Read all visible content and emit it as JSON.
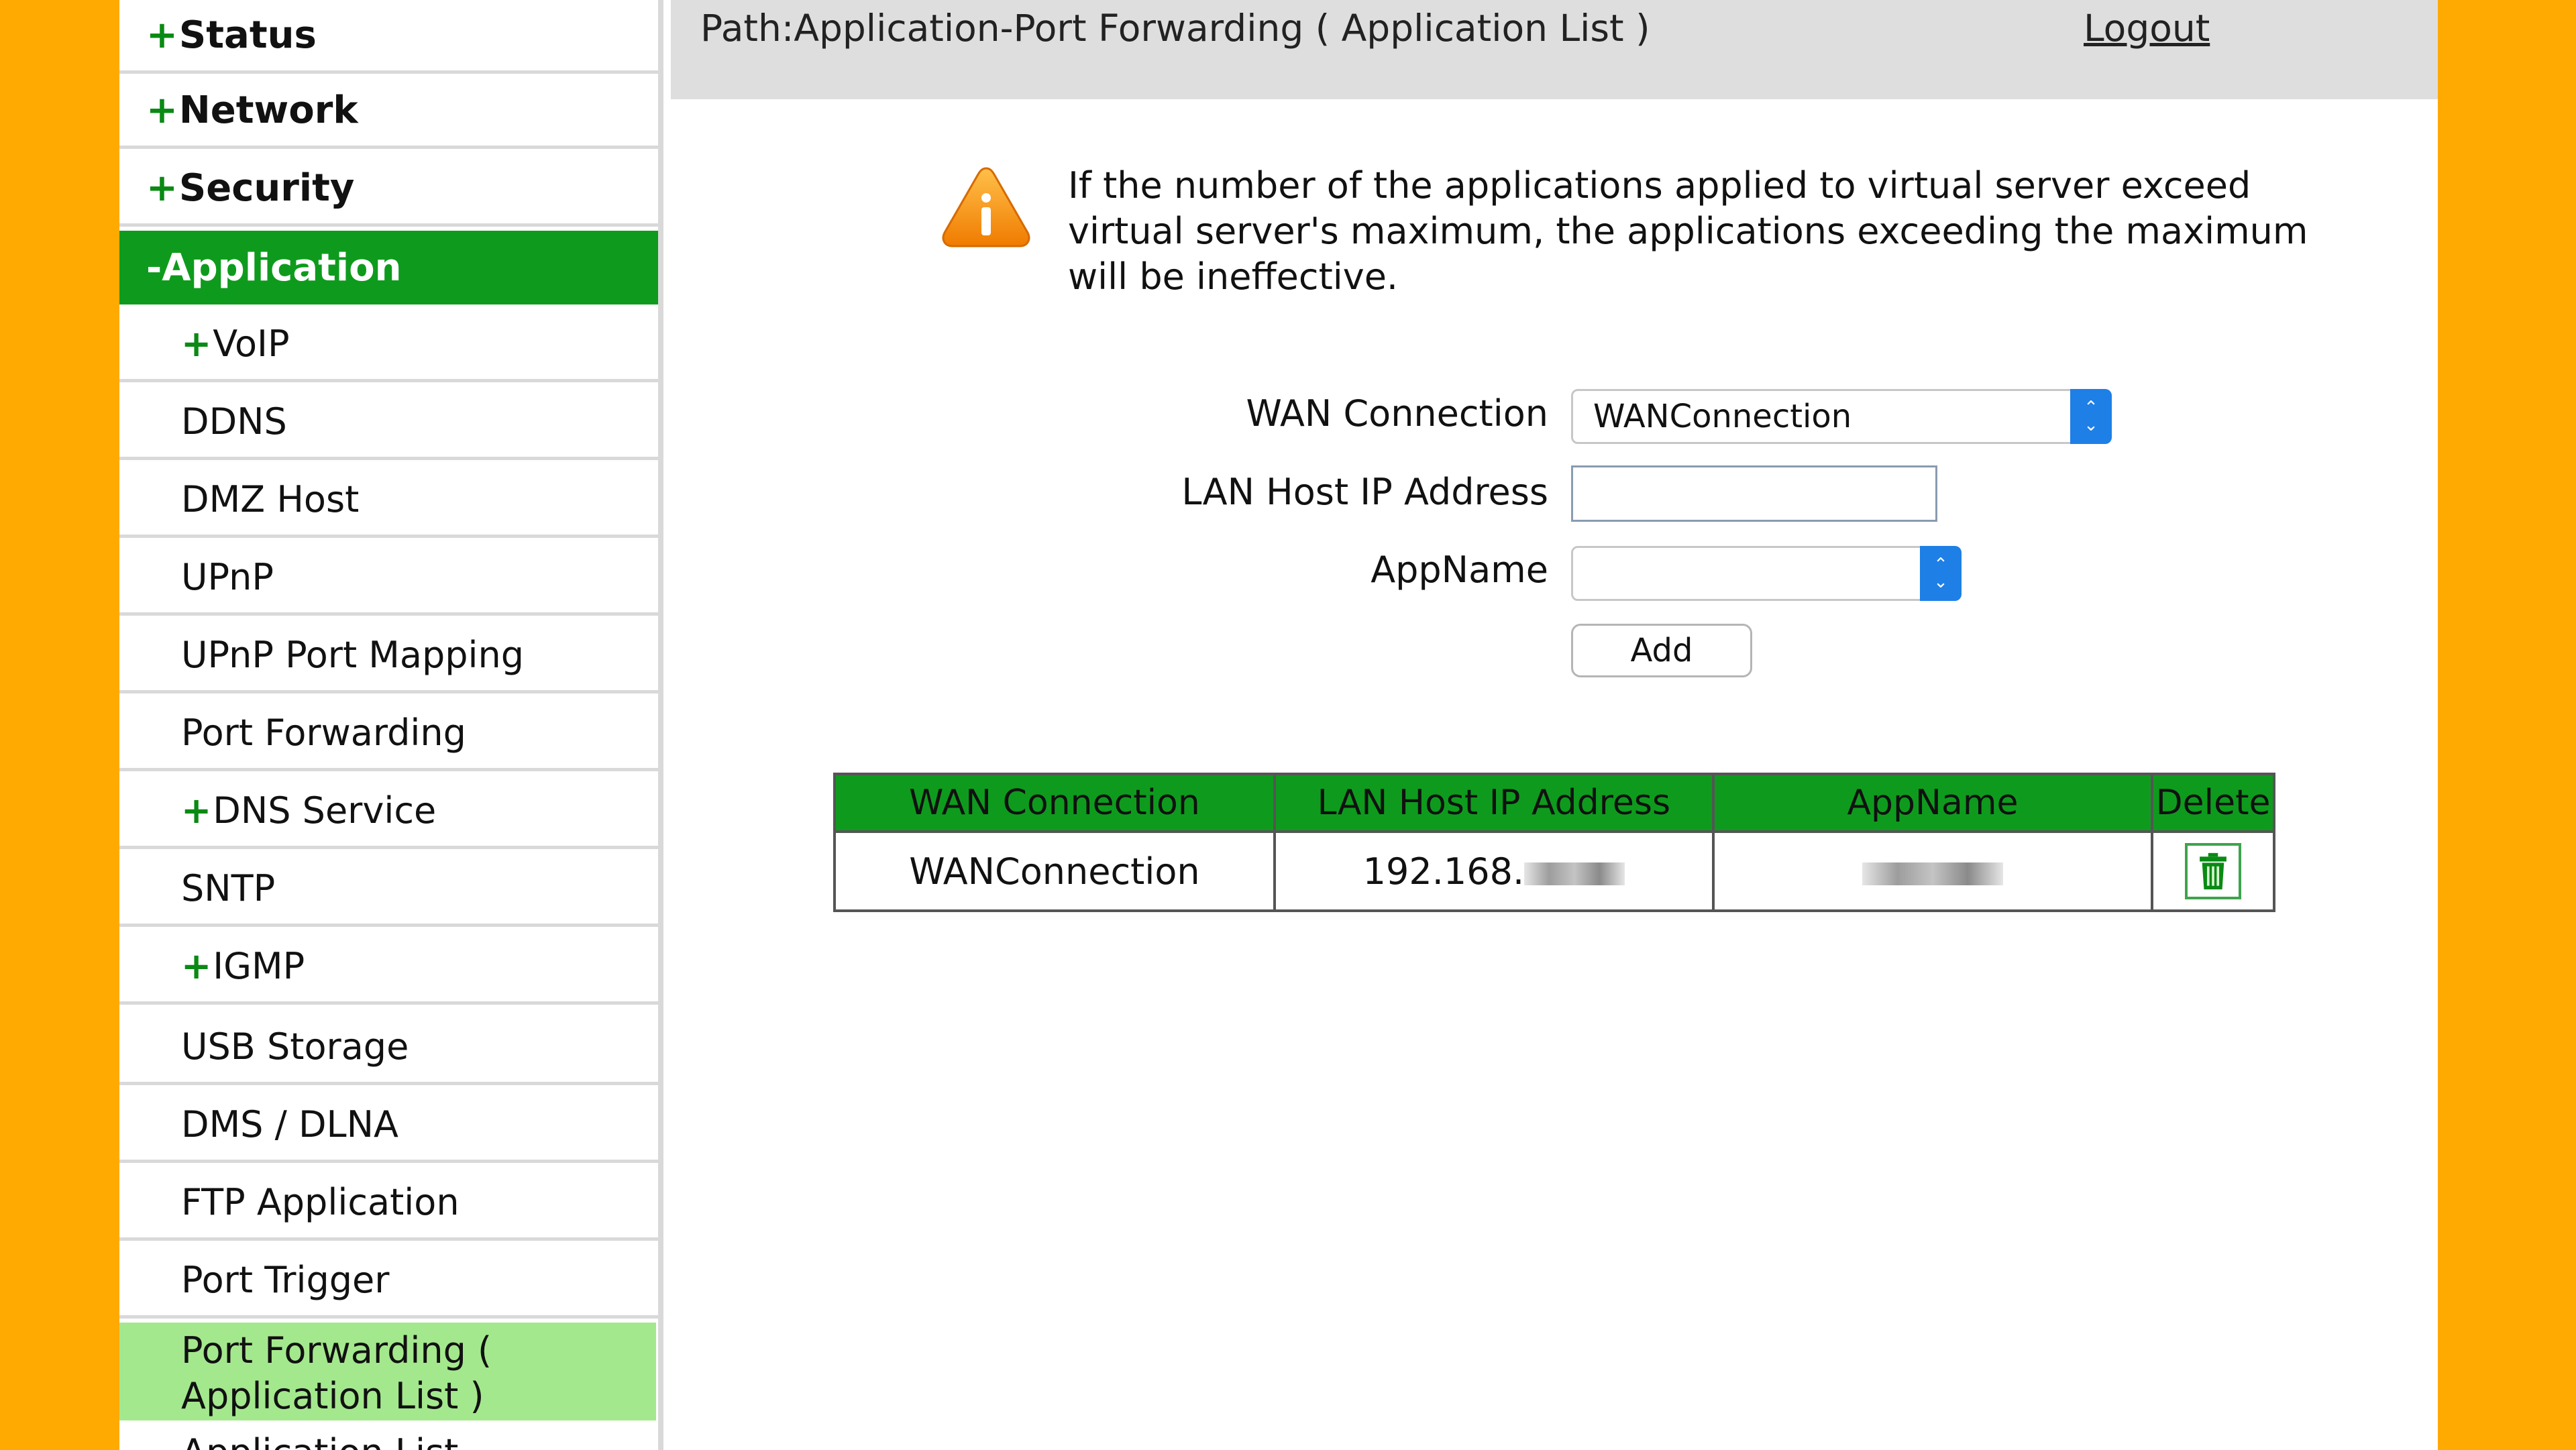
{
  "header": {
    "path": "Path:Application-Port Forwarding ( Application List )",
    "logout": "Logout"
  },
  "sidebar": {
    "items": [
      {
        "prefix": "+",
        "label": "Status"
      },
      {
        "prefix": "+",
        "label": "Network"
      },
      {
        "prefix": "+",
        "label": "Security"
      },
      {
        "prefix": "-",
        "label": "Application"
      },
      {
        "prefix": "+",
        "label": "VoIP"
      },
      {
        "label": "DDNS"
      },
      {
        "label": "DMZ Host"
      },
      {
        "label": "UPnP"
      },
      {
        "label": "UPnP Port Mapping"
      },
      {
        "label": "Port Forwarding"
      },
      {
        "prefix": "+",
        "label": "DNS Service"
      },
      {
        "label": "SNTP"
      },
      {
        "prefix": "+",
        "label": "IGMP"
      },
      {
        "label": "USB Storage"
      },
      {
        "label": "DMS / DLNA"
      },
      {
        "label": "FTP Application"
      },
      {
        "label": "Port Trigger"
      },
      {
        "label": "Port Forwarding ( Application List )"
      },
      {
        "label": "Application List"
      }
    ]
  },
  "warning": {
    "text": "If the number of the applications applied to virtual server exceed virtual server's maximum, the applications exceeding the maximum will be ineffective.",
    "icon": "warning-icon"
  },
  "form": {
    "wan_label": "WAN Connection",
    "wan_value": "WANConnection",
    "lan_label": "LAN Host IP Address",
    "lan_value": "",
    "app_label": "AppName",
    "app_value": "",
    "add_label": "Add"
  },
  "table": {
    "headers": [
      "WAN Connection",
      "LAN Host IP Address",
      "AppName",
      "Delete"
    ],
    "rows": [
      {
        "wan": "WANConnection",
        "ip": "192.168.",
        "app": ""
      }
    ]
  },
  "colors": {
    "background": "#FFAA00",
    "accent_green": "#0e9b1d",
    "current_item": "#a4e88d",
    "select_arrow": "#1e7fe6"
  }
}
